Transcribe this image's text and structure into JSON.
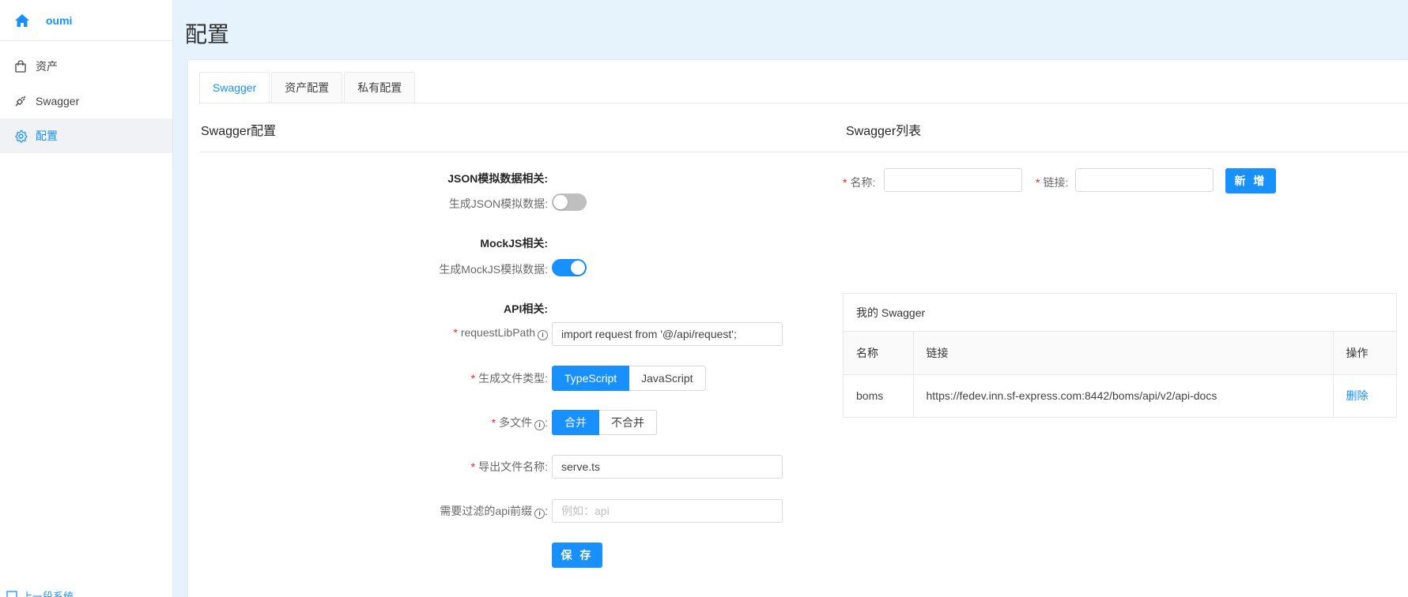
{
  "sidebar": {
    "brand": "oumi",
    "items": [
      {
        "label": "资产",
        "icon": "shopping-bag-icon"
      },
      {
        "label": "Swagger",
        "icon": "api-plug-icon"
      },
      {
        "label": "配置",
        "icon": "gear-icon",
        "active": true
      }
    ],
    "bottom_label": "上一段系统"
  },
  "header": {
    "title": "配置"
  },
  "tabs": [
    {
      "label": "Swagger",
      "active": true
    },
    {
      "label": "资产配置"
    },
    {
      "label": "私有配置"
    }
  ],
  "left_panel": {
    "title": "Swagger配置",
    "json_group": {
      "title": "JSON模拟数据相关:",
      "switch_label": "生成JSON模拟数据:",
      "switch_on": false
    },
    "mock_group": {
      "title": "MockJS相关:",
      "switch_label": "生成MockJS模拟数据:",
      "switch_on": true
    },
    "api_group": {
      "title": "API相关:"
    },
    "request_lib": {
      "label": "requestLibPath",
      "value": "import request from '@/api/request';"
    },
    "file_type": {
      "label": "生成文件类型:",
      "options": [
        "TypeScript",
        "JavaScript"
      ],
      "selected": "TypeScript"
    },
    "multi_file": {
      "label": "多文件",
      "options": [
        "合并",
        "不合并"
      ],
      "selected": "合并"
    },
    "export_name": {
      "label": "导出文件名称:",
      "value": "serve.ts"
    },
    "filter_prefix": {
      "label": "需要过滤的api前缀",
      "placeholder": "例如：api"
    },
    "save_label": "保 存"
  },
  "right_panel": {
    "title": "Swagger列表",
    "name_label": "名称:",
    "link_label": "链接:",
    "add_label": "新 增",
    "table": {
      "title": "我的 Swagger",
      "columns": [
        "名称",
        "链接",
        "操作"
      ],
      "rows": [
        {
          "name": "boms",
          "link": "https://fedev.inn.sf-express.com:8442/boms/api/v2/api-docs",
          "action": "删除"
        }
      ]
    }
  },
  "colors": {
    "primary": "#1890ff",
    "required": "#f5222d",
    "page_bg": "#e6f2fc"
  }
}
